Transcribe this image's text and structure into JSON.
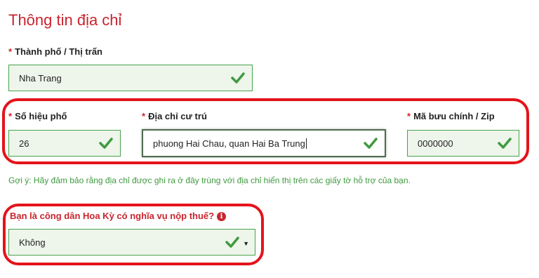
{
  "section_title": "Thông tin địa chỉ",
  "required_mark": "*",
  "city": {
    "label": "Thành phố / Thị trấn",
    "value": "Nha Trang"
  },
  "street_number": {
    "label": "Số hiệu phố",
    "value": "26"
  },
  "address": {
    "label": "Địa chỉ cư trú",
    "value": "phuong Hai Chau, quan Hai Ba Trung"
  },
  "zip": {
    "label": "Mã bưu chính / Zip",
    "value": "0000000"
  },
  "hint": "Gợi ý: Hãy đảm bảo rằng địa chỉ được ghi ra ở đây trùng với địa chỉ hiển thị trên các giấy tờ hỗ trợ của bạn.",
  "us_tax_question": {
    "label": "Bạn là công dân Hoa Kỳ có nghĩa vụ nộp thuế?",
    "selected": "Không"
  },
  "icons": {
    "valid": "checkmark-icon",
    "info": "info-icon",
    "dropdown": "caret-down-icon"
  },
  "colors": {
    "accent": "#c9252d",
    "valid": "#3f9a3f",
    "highlight": "#e4131b",
    "field_bg": "#eef5ea"
  }
}
